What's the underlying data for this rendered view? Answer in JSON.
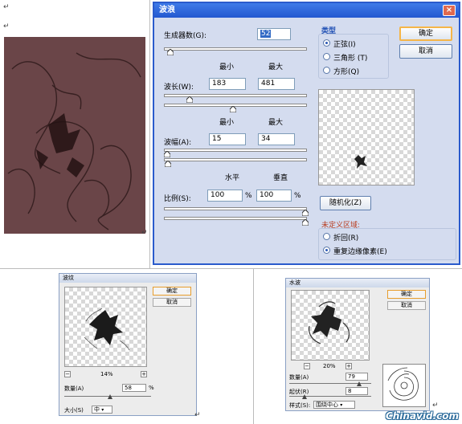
{
  "marks": {
    "para": "↵",
    "ret": "↵"
  },
  "wave": {
    "title": "波浪",
    "generators_label": "生成器数(G):",
    "generators_value": "52",
    "min_label": "最小",
    "max_label": "最大",
    "wavelength_label": "波长(W):",
    "wavelength_min": "183",
    "wavelength_max": "481",
    "amplitude_label": "波幅(A):",
    "amplitude_min": "15",
    "amplitude_max": "34",
    "horizontal_label": "水平",
    "vertical_label": "垂直",
    "scale_label": "比例(S):",
    "scale_h": "100",
    "scale_v": "100",
    "percent": "%",
    "type_label": "类型",
    "type_options": [
      "正弦(I)",
      "三角形 (T)",
      "方形(Q)"
    ],
    "ok": "确定",
    "cancel": "取消",
    "randomize": "随机化(Z)",
    "undefined_label": "未定义区域:",
    "undefined_options": [
      "折回(R)",
      "重复边缘像素(E)"
    ],
    "close": "×"
  },
  "ripple": {
    "title": "波纹",
    "ok": "确定",
    "cancel": "取消",
    "zoom": "14%",
    "minus": "−",
    "plus": "+",
    "amount_label": "数量(A)",
    "amount_value": "58",
    "percent": "%",
    "size_label": "大小(S)",
    "size_value": "中"
  },
  "water": {
    "title": "水波",
    "ok": "确定",
    "cancel": "取消",
    "zoom": "20%",
    "minus": "−",
    "plus": "+",
    "amount_label": "数量(A)",
    "amount_value": "79",
    "ridges_label": "起伏(R)",
    "ridges_value": "8",
    "style_label": "样式(S):",
    "style_value": "围绕中心"
  },
  "watermark": "Chinavid.com"
}
